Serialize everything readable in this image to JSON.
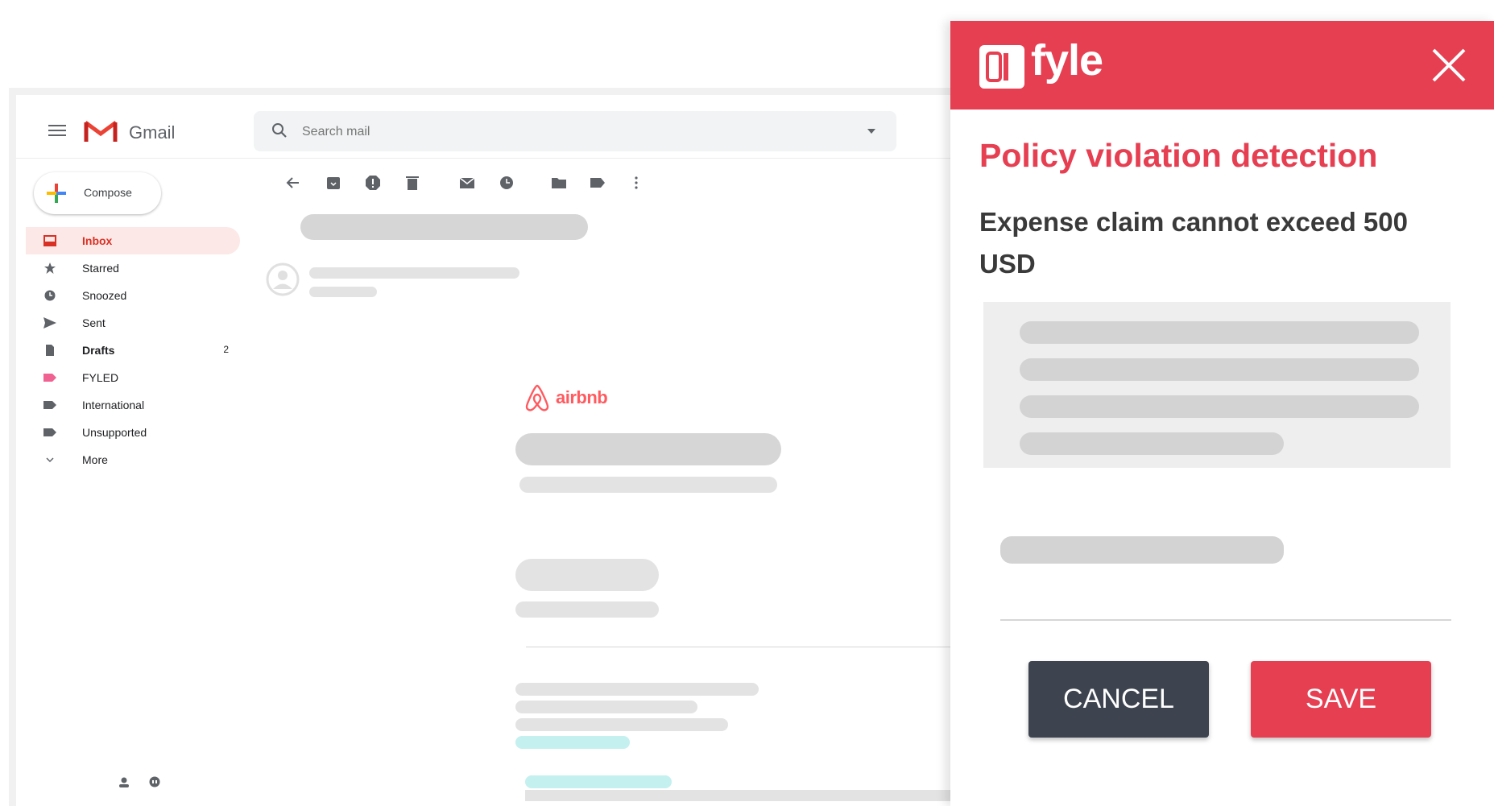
{
  "gmail": {
    "wordmark": "Gmail",
    "search": {
      "placeholder": "Search mail"
    },
    "compose_label": "Compose",
    "nav": [
      {
        "label": "Inbox",
        "icon": "inbox-icon",
        "active": true
      },
      {
        "label": "Starred",
        "icon": "star-icon"
      },
      {
        "label": "Snoozed",
        "icon": "clock-icon"
      },
      {
        "label": "Sent",
        "icon": "send-icon"
      },
      {
        "label": "Drafts",
        "icon": "draft-icon",
        "count": "2"
      },
      {
        "label": "FYLED",
        "icon": "label-icon",
        "color": "#f06292"
      },
      {
        "label": "International",
        "icon": "label-icon"
      },
      {
        "label": "Unsupported",
        "icon": "label-icon"
      },
      {
        "label": "More",
        "icon": "chevron-down-icon"
      }
    ],
    "email_brand": "airbnb"
  },
  "fyle": {
    "brand": "fyle",
    "title": "Policy violation detection",
    "message": "Expense claim cannot exceed 500 USD",
    "cancel_label": "CANCEL",
    "save_label": "SAVE",
    "colors": {
      "accent": "#e63f52",
      "cancel": "#3d444f"
    }
  }
}
